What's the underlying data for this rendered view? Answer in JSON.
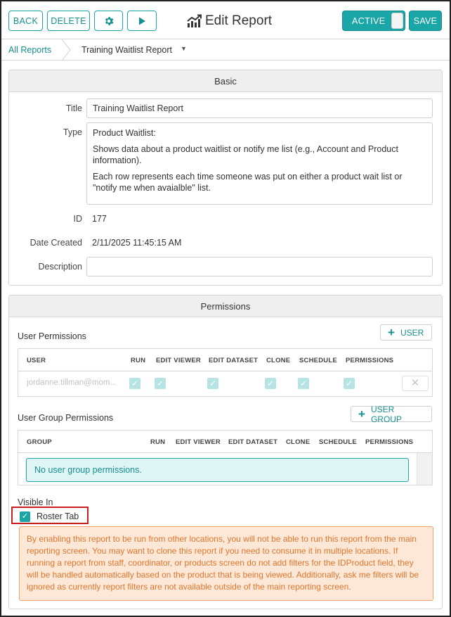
{
  "toolbar": {
    "back_label": "BACK",
    "delete_label": "DELETE",
    "title": "Edit Report",
    "active_label": "ACTIVE",
    "save_label": "SAVE"
  },
  "breadcrumb": {
    "root": "All Reports",
    "current": "Training Waitlist Report"
  },
  "basic": {
    "heading": "Basic",
    "title_label": "Title",
    "title_value": "Training Waitlist Report",
    "type_label": "Type",
    "type_lines": [
      "Product Waitlist:",
      "Shows data about a product waitlist or notify me list (e.g., Account and Product information).",
      "Each row represents each time someone was put on either a product wait list or \"notify me when avaialble\" list."
    ],
    "id_label": "ID",
    "id_value": "177",
    "date_label": "Date Created",
    "date_value": "2/11/2025 11:45:15 AM",
    "description_label": "Description",
    "description_value": ""
  },
  "permissions": {
    "heading": "Permissions",
    "user_section_label": "User Permissions",
    "add_user_label": "USER",
    "user_columns": [
      "USER",
      "RUN",
      "EDIT VIEWER",
      "EDIT DATASET",
      "CLONE",
      "SCHEDULE",
      "PERMISSIONS"
    ],
    "user_rows": [
      {
        "user": "jordanne.tillman@mom...",
        "run": true,
        "edit_viewer": true,
        "edit_dataset": true,
        "clone": true,
        "schedule": true,
        "permissions": true
      }
    ],
    "group_section_label": "User Group Permissions",
    "add_group_label": "USER GROUP",
    "group_columns": [
      "GROUP",
      "RUN",
      "EDIT VIEWER",
      "EDIT DATASET",
      "CLONE",
      "SCHEDULE",
      "PERMISSIONS"
    ],
    "group_empty": "No user group permissions.",
    "visible_in_label": "Visible In",
    "roster_tab_label": "Roster Tab",
    "roster_tab_checked": true,
    "warning_text": "By enabling this report to be run from other locations, you will not be able to run this report from the main reporting screen. You may want to clone this report if you need to consume it in multiple locations. If running a report from staff, coordinator, or products screen do not add filters for the IDProduct field, they will be handled automatically based on the product that is being viewed. Additionally, ask me filters will be ignored as currently report filters are not available outside of the main reporting screen."
  },
  "colors": {
    "accent": "#1aa5a7",
    "warning_bg": "#fde8d7",
    "warning_text": "#e0752c",
    "highlight_border": "#c81e1e"
  }
}
